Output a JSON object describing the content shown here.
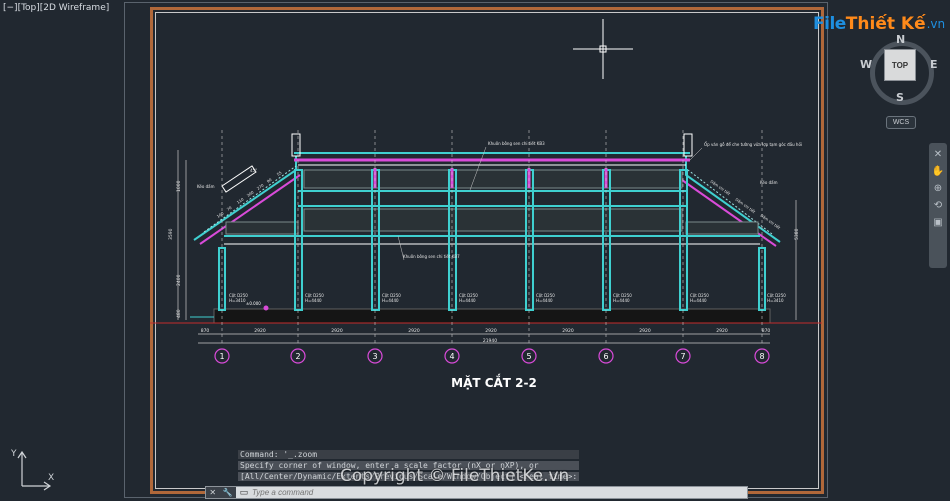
{
  "viewport": {
    "label": "[−][Top][2D Wireframe]"
  },
  "logo": {
    "part1": "File",
    "part2": "Thiết Kế",
    "tld": ".vn"
  },
  "viewcube": {
    "top": "TOP",
    "north": "N",
    "south": "S",
    "west": "W",
    "east": "E",
    "wcs": "WCS"
  },
  "navbar": {
    "icons": [
      "pan-icon",
      "zoom-icon",
      "orbit-icon",
      "showmotion-icon"
    ]
  },
  "drawing": {
    "title": "MẶT CẮT  2-2",
    "total_dim": "21940",
    "elevation": "±0.000",
    "grid_labels": [
      "1",
      "2",
      "3",
      "4",
      "5",
      "6",
      "7",
      "8"
    ],
    "spans": [
      "2920",
      "2920",
      "2920",
      "2920",
      "2920",
      "2920",
      "2920"
    ],
    "end_dims": [
      "870",
      "870"
    ],
    "column_labels": [
      {
        "name": "Cột D250",
        "h": "H=3410"
      },
      {
        "name": "Cột D250",
        "h": "H=4440"
      },
      {
        "name": "Cột D250",
        "h": "H=4440"
      },
      {
        "name": "Cột D250",
        "h": "H=4440"
      },
      {
        "name": "Cột D250",
        "h": "H=4440"
      },
      {
        "name": "Cột D250",
        "h": "H=4440"
      },
      {
        "name": "Cột D250",
        "h": "H=4440"
      },
      {
        "name": "Cột D250",
        "h": "H=3410"
      }
    ],
    "notes": [
      "Khuôn bông sen chi tiết KB3",
      "Khuôn bông sen chi tiết KB7",
      "Ốp ván gỗ để che tường vữa lợp tạm góc đầu hồi",
      "Kéo dấm",
      "Kéo dấm"
    ],
    "vertical_dims": [
      "1000",
      "3590",
      "2400",
      "480",
      "5380"
    ],
    "slope": "45°",
    "rafter_marks_left": [
      "100",
      "70",
      "110",
      "300",
      "270",
      "90",
      "55"
    ],
    "rafter_marks_right": [
      "Dầm chi tiết",
      "Dầm chi tiết",
      "Dầm chi tiết"
    ]
  },
  "command": {
    "history": [
      "Command: '_.zoom",
      "Specify corner of window, enter a scale factor (nX or nXP), or",
      "[All/Center/Dynamic/Extents/Previous/Scale/Window/Object] <real time>:"
    ],
    "placeholder": "Type a command"
  },
  "ucs": {
    "y": "Y",
    "x": "X"
  },
  "watermark": "Copyright © FileThietKe.vn",
  "colors": {
    "background": "#212830",
    "frame": "#b0683a",
    "cyan": "#3fd0d0",
    "magenta": "#d94bd9",
    "white": "#ffffff",
    "grid_line": "#c9c9c9"
  }
}
